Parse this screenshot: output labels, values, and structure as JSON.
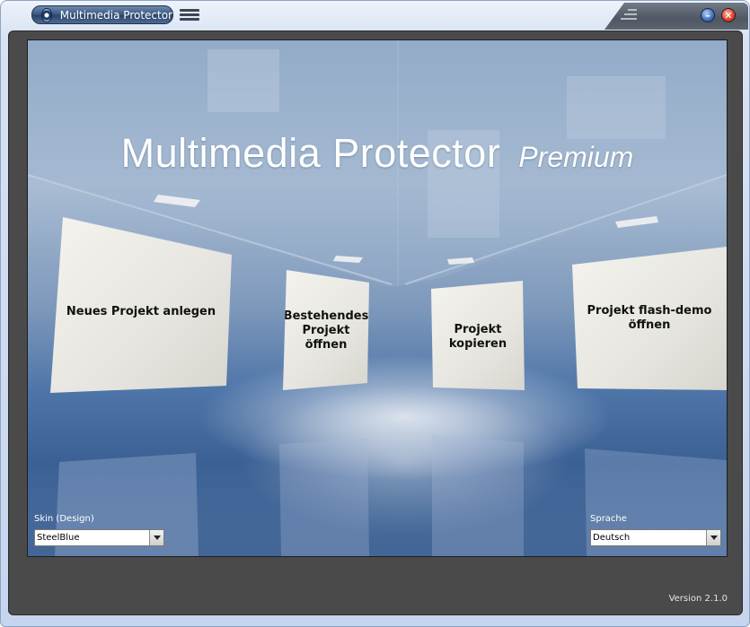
{
  "window": {
    "title": "Multimedia Protector"
  },
  "header": {
    "title": "Multimedia Protector",
    "edition": "Premium"
  },
  "panels": [
    {
      "label": "Neues Projekt anlegen"
    },
    {
      "line1": "Bestehendes",
      "line2": "Projekt",
      "line3": "öffnen"
    },
    {
      "line1": "Projekt",
      "line2": "kopieren"
    },
    {
      "line1": "Projekt flash-demo",
      "line2": "öffnen"
    }
  ],
  "skin": {
    "label": "Skin (Design)",
    "value": "SteelBlue"
  },
  "language": {
    "label": "Sprache",
    "value": "Deutsch"
  },
  "footer": {
    "version": "Version 2.1.0"
  },
  "icons": {
    "app": "app-icon",
    "menu": "hamburger-menu-icon",
    "grip": "grip-icon",
    "minimize": "minimize-icon",
    "close": "close-icon",
    "dropdown": "chevron-down-icon"
  },
  "colors": {
    "frame": "#4a4a4a",
    "title_pill": "#3f5b83",
    "minimize": "#3a6fc0",
    "close": "#e03b1e",
    "background_blue": "#4e75a8"
  }
}
